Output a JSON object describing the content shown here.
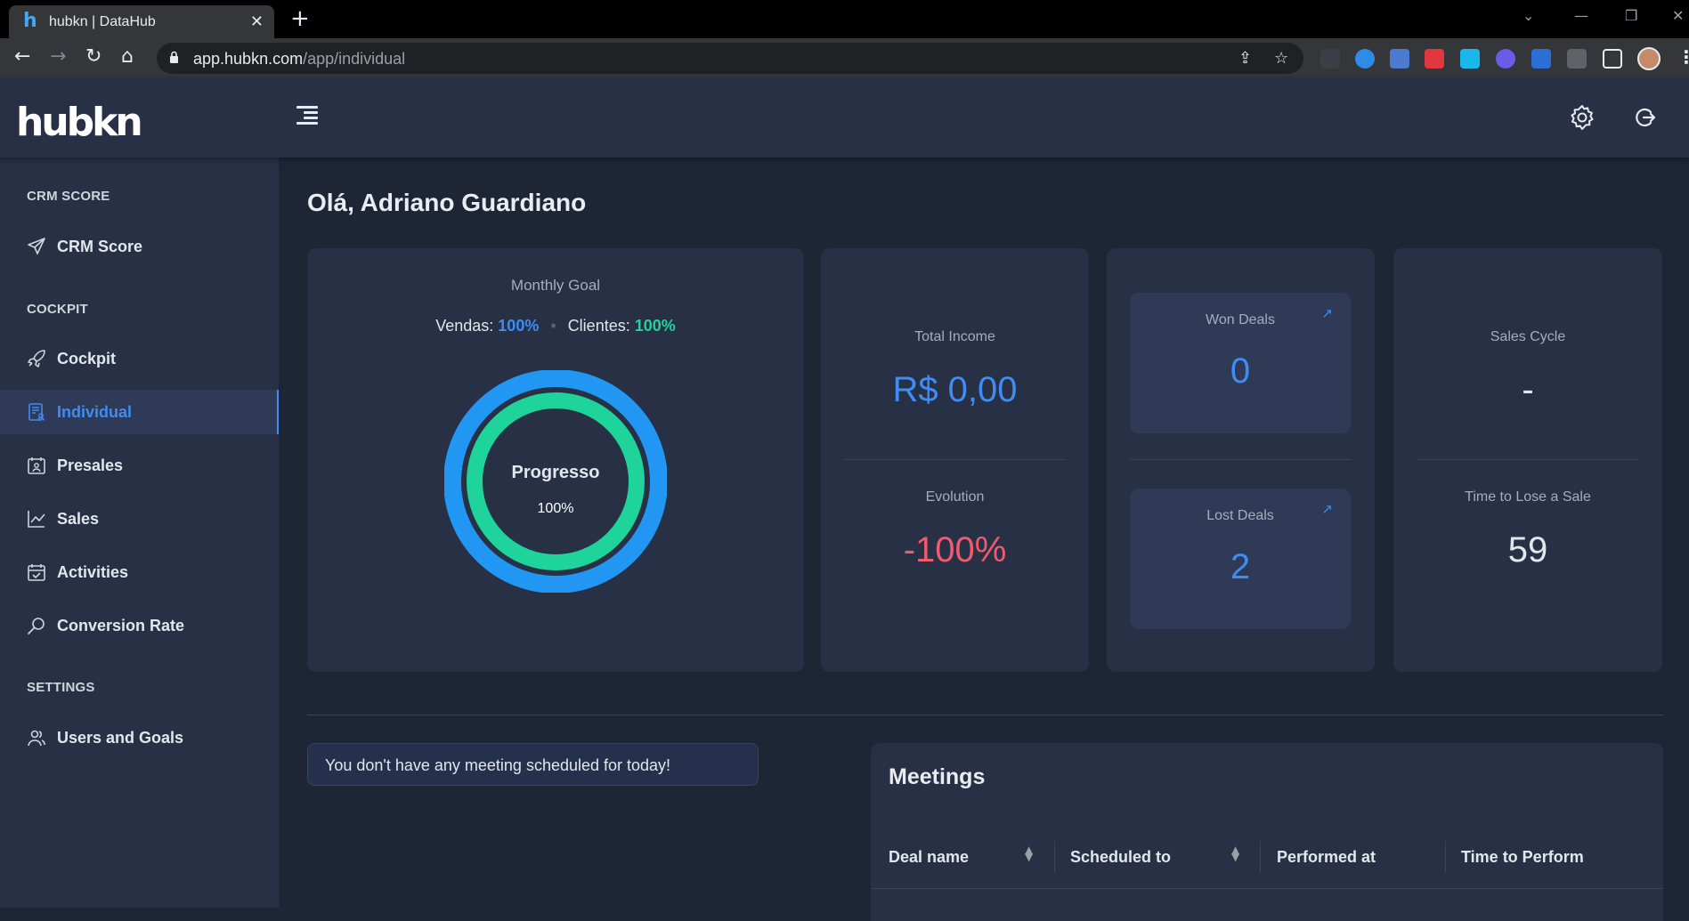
{
  "browser": {
    "tab_title": "hubkn | DataHub",
    "url_host": "app.hubkn.com",
    "url_path": "/app/individual"
  },
  "app": {
    "logo_text": "hubkn",
    "greeting": "Olá, Adriano Guardiano"
  },
  "sidebar": {
    "sections": [
      {
        "title": "CRM SCORE",
        "items": [
          {
            "label": "CRM Score",
            "icon": "send-icon"
          }
        ]
      },
      {
        "title": "COCKPIT",
        "items": [
          {
            "label": "Cockpit",
            "icon": "rocket-icon"
          },
          {
            "label": "Individual",
            "icon": "document-person-icon",
            "active": true
          },
          {
            "label": "Presales",
            "icon": "calendar-person-icon"
          },
          {
            "label": "Sales",
            "icon": "line-chart-icon"
          },
          {
            "label": "Activities",
            "icon": "calendar-check-icon"
          },
          {
            "label": "Conversion Rate",
            "icon": "search-icon"
          }
        ]
      },
      {
        "title": "SETTINGS",
        "items": [
          {
            "label": "Users and Goals",
            "icon": "users-icon"
          }
        ]
      }
    ]
  },
  "monthly_goal": {
    "title": "Monthly Goal",
    "vendas_label": "Vendas:",
    "vendas_value": "100%",
    "clientes_label": "Clientes:",
    "clientes_value": "100%",
    "progress_label": "Progresso",
    "progress_value": "100%",
    "outer_ring_fraction": 1.0,
    "inner_ring_fraction": 1.0
  },
  "income": {
    "total_label": "Total Income",
    "total_value": "R$ 0,00",
    "evolution_label": "Evolution",
    "evolution_value": "-100%"
  },
  "deals": {
    "won_label": "Won Deals",
    "won_value": "0",
    "lost_label": "Lost Deals",
    "lost_value": "2"
  },
  "cycle": {
    "sales_cycle_label": "Sales Cycle",
    "sales_cycle_value": "-",
    "time_to_lose_label": "Time to Lose a Sale",
    "time_to_lose_value": "59"
  },
  "notice": "You don't have any meeting scheduled for today!",
  "meetings": {
    "title": "Meetings",
    "columns": [
      "Deal name",
      "Scheduled to",
      "Performed at",
      "Time to Perform"
    ]
  },
  "colors": {
    "accent_blue": "#3f8cf2",
    "green": "#1ed49a",
    "red": "#ef5a6f",
    "ring_outer": "#2196f3",
    "ring_inner": "#1ed49a"
  }
}
